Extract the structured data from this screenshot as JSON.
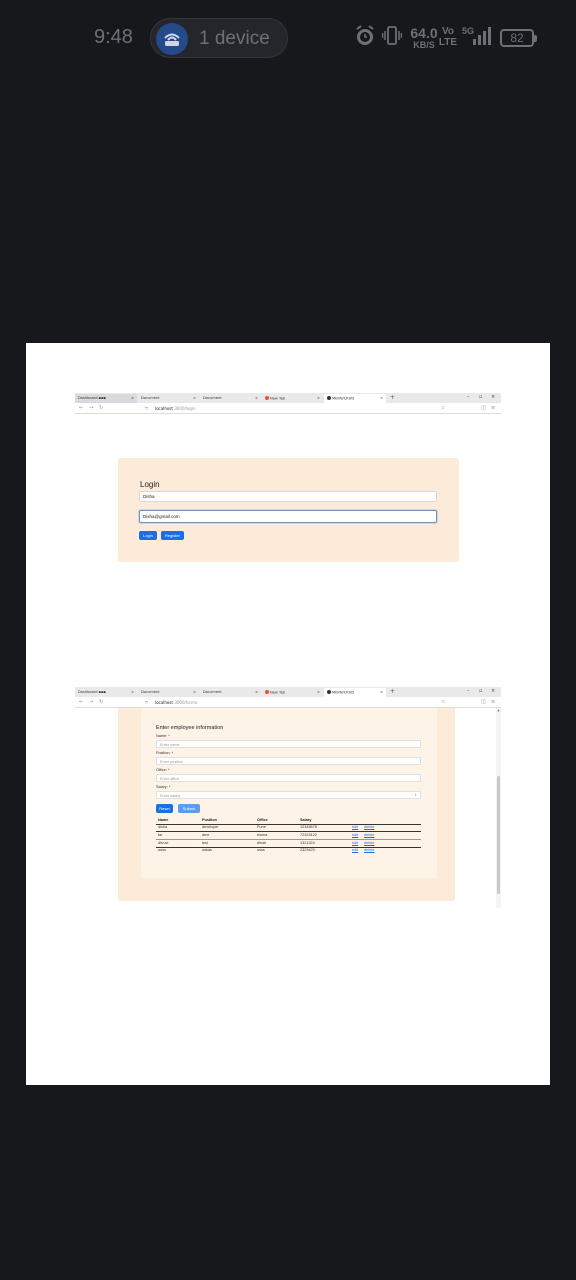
{
  "status_bar": {
    "time": "9:48",
    "cast_label": "1 device",
    "net_speed_value": "64.0",
    "net_speed_unit": "KB/S",
    "volte_top": "Vo",
    "volte_bottom": "LTE",
    "network": "5G",
    "battery": "82"
  },
  "browser1": {
    "tabs": [
      {
        "label": "Dashboard ▪▪▪",
        "state": "inactive"
      },
      {
        "label": "Document",
        "state": "inactive"
      },
      {
        "label": "Document",
        "state": "inactive"
      },
      {
        "label": "New Tab",
        "state": "inactive"
      },
      {
        "label": "MERN/CRUD",
        "state": "active"
      }
    ],
    "new_tab": "+",
    "url_host": "localhost",
    "url_path": ":3000/login"
  },
  "login": {
    "title": "Login",
    "username_value": "Disha",
    "email_value": "Disha@gmail.com",
    "login_button": "Login",
    "register_button": "Register"
  },
  "browser2": {
    "tabs": [
      {
        "label": "Dashboard ▪▪▪",
        "state": "inactive"
      },
      {
        "label": "Document",
        "state": "inactive"
      },
      {
        "label": "Document",
        "state": "inactive"
      },
      {
        "label": "New Tab",
        "state": "inactive"
      },
      {
        "label": "MERN/CRUD",
        "state": "active"
      }
    ],
    "new_tab": "+",
    "url_host": "localhost",
    "url_path": ":3000/home"
  },
  "employee_form": {
    "title": "Enter employee information",
    "fields": [
      {
        "label": "Name: *",
        "placeholder": "Enter name"
      },
      {
        "label": "Position: *",
        "placeholder": "Enter position"
      },
      {
        "label": "Office: *",
        "placeholder": "Enter office"
      },
      {
        "label": "Salary: *",
        "placeholder": "Enter salary"
      }
    ],
    "reset_button": "Reset",
    "submit_button": "Submit"
  },
  "employee_table": {
    "headers": [
      "Name",
      "Position",
      "Office",
      "Salary"
    ],
    "rows": [
      {
        "name": "disha",
        "position": "developer",
        "office": "Pune",
        "salary": "12345678",
        "edit": "edit",
        "delete": "delete"
      },
      {
        "name": "tar",
        "position": "devr",
        "office": "eiuma",
        "salary": "72323122",
        "edit": "edit",
        "delete": "delete"
      },
      {
        "name": "dhruvi",
        "position": "test",
        "office": "dhuih",
        "salary": "1321324",
        "edit": "edit",
        "delete": "delete"
      },
      {
        "name": "osos",
        "position": "oskas",
        "office": "osss",
        "salary": "2323423",
        "edit": "edit",
        "delete": "delete"
      }
    ]
  },
  "colors": {
    "panel_bg": "#fbebd8",
    "button_blue": "#1a6fe5",
    "phone_bg": "#17181c"
  }
}
